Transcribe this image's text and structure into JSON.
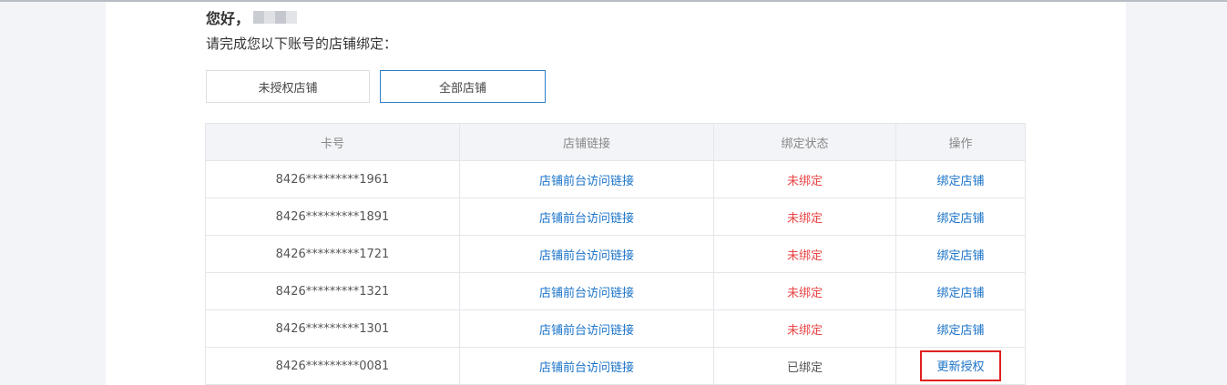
{
  "greeting": {
    "prefix": "您好，"
  },
  "instruction": "请完成您以下账号的店铺绑定：",
  "tabs": [
    {
      "label": "未授权店铺",
      "active": false
    },
    {
      "label": "全部店铺",
      "active": true
    }
  ],
  "table": {
    "headers": [
      "卡号",
      "店铺链接",
      "绑定状态",
      "操作"
    ],
    "rows": [
      {
        "card": "8426*********1961",
        "link": "店铺前台访问链接",
        "status": "未绑定",
        "action": "绑定店铺"
      },
      {
        "card": "8426*********1891",
        "link": "店铺前台访问链接",
        "status": "未绑定",
        "action": "绑定店铺"
      },
      {
        "card": "8426*********1721",
        "link": "店铺前台访问链接",
        "status": "未绑定",
        "action": "绑定店铺"
      },
      {
        "card": "8426*********1321",
        "link": "店铺前台访问链接",
        "status": "未绑定",
        "action": "绑定店铺"
      },
      {
        "card": "8426*********1301",
        "link": "店铺前台访问链接",
        "status": "未绑定",
        "action": "绑定店铺"
      },
      {
        "card": "8426*********0081",
        "link": "店铺前台访问链接",
        "status": "已绑定",
        "action": "更新授权"
      }
    ]
  },
  "colors": {
    "link": "#1a73c8",
    "unbound": "#e84545",
    "active_tab_border": "#2c7ec8",
    "highlight_box": "#e02020"
  }
}
